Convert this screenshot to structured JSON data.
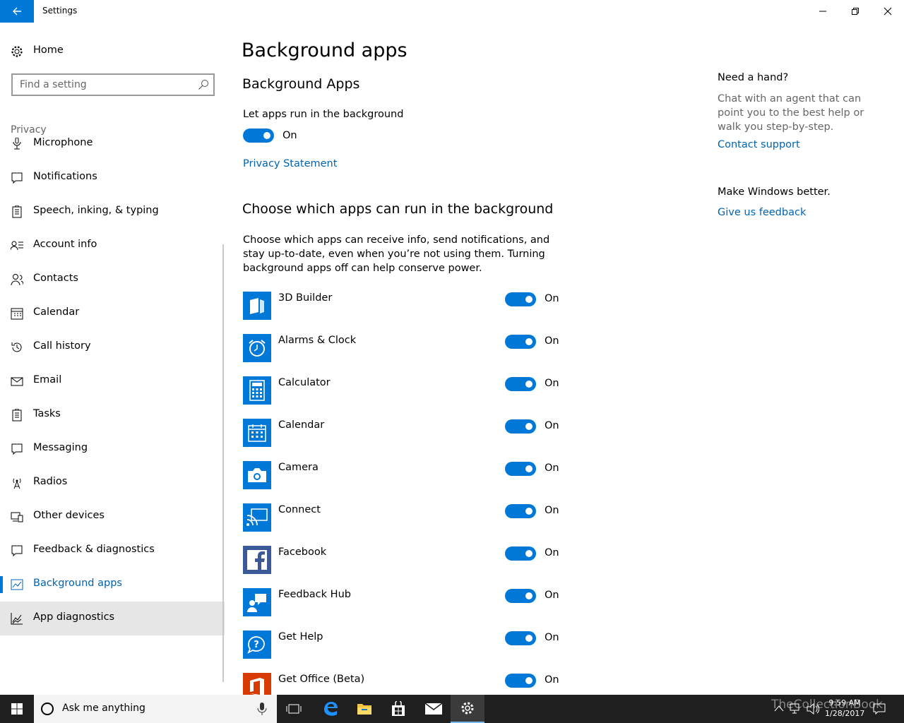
{
  "window": {
    "title": "Settings"
  },
  "sidebar": {
    "home_label": "Home",
    "search_placeholder": "Find a setting",
    "section": "Privacy",
    "items": [
      {
        "label": "Microphone",
        "icon": "microphone-icon"
      },
      {
        "label": "Notifications",
        "icon": "notifications-icon"
      },
      {
        "label": "Speech, inking, & typing",
        "icon": "speech-icon"
      },
      {
        "label": "Account info",
        "icon": "account-info-icon"
      },
      {
        "label": "Contacts",
        "icon": "contacts-icon"
      },
      {
        "label": "Calendar",
        "icon": "calendar-icon"
      },
      {
        "label": "Call history",
        "icon": "history-icon"
      },
      {
        "label": "Email",
        "icon": "email-icon"
      },
      {
        "label": "Tasks",
        "icon": "tasks-icon"
      },
      {
        "label": "Messaging",
        "icon": "messaging-icon"
      },
      {
        "label": "Radios",
        "icon": "radio-icon"
      },
      {
        "label": "Other devices",
        "icon": "devices-icon"
      },
      {
        "label": "Feedback & diagnostics",
        "icon": "feedback-icon"
      },
      {
        "label": "Background apps",
        "icon": "background-apps-icon",
        "active": true
      },
      {
        "label": "App diagnostics",
        "icon": "app-diagnostics-icon"
      }
    ]
  },
  "main": {
    "title": "Background apps",
    "section1_title": "Background Apps",
    "let_apps_label": "Let apps run in the background",
    "let_apps_state": "On",
    "privacy_link": "Privacy Statement",
    "section2_title": "Choose which apps can run in the background",
    "description": "Choose which apps can receive info, send notifications, and stay up-to-date, even when you’re not using them. Turning background apps off can help conserve power.",
    "apps": [
      {
        "name": "3D Builder",
        "state": "On",
        "icon": "3d-builder-icon",
        "color": "#0078d7"
      },
      {
        "name": "Alarms & Clock",
        "state": "On",
        "icon": "alarm-clock-icon",
        "color": "#0078d7"
      },
      {
        "name": "Calculator",
        "state": "On",
        "icon": "calculator-icon",
        "color": "#0078d7"
      },
      {
        "name": "Calendar",
        "state": "On",
        "icon": "calendar-app-icon",
        "color": "#0078d7"
      },
      {
        "name": "Camera",
        "state": "On",
        "icon": "camera-icon",
        "color": "#0078d7"
      },
      {
        "name": "Connect",
        "state": "On",
        "icon": "connect-icon",
        "color": "#0078d7"
      },
      {
        "name": "Facebook",
        "state": "On",
        "icon": "facebook-icon",
        "color": "#3b5998"
      },
      {
        "name": "Feedback Hub",
        "state": "On",
        "icon": "feedback-hub-icon",
        "color": "#0078d7"
      },
      {
        "name": "Get Help",
        "state": "On",
        "icon": "get-help-icon",
        "color": "#0078d7"
      },
      {
        "name": "Get Office (Beta)",
        "state": "On",
        "icon": "office-icon",
        "color": "#d83b01"
      }
    ]
  },
  "help": {
    "heading": "Need a hand?",
    "text": "Chat with an agent that can point you to the best help or walk you step-by-step.",
    "contact_link": "Contact support",
    "heading2": "Make Windows better.",
    "feedback_link": "Give us feedback"
  },
  "taskbar": {
    "search_placeholder": "Ask me anything",
    "time": "9:59 AM",
    "date": "1/28/2017",
    "watermark": "TheCollectionBook"
  },
  "colors": {
    "accent": "#0078d7",
    "link": "#0063b1"
  }
}
